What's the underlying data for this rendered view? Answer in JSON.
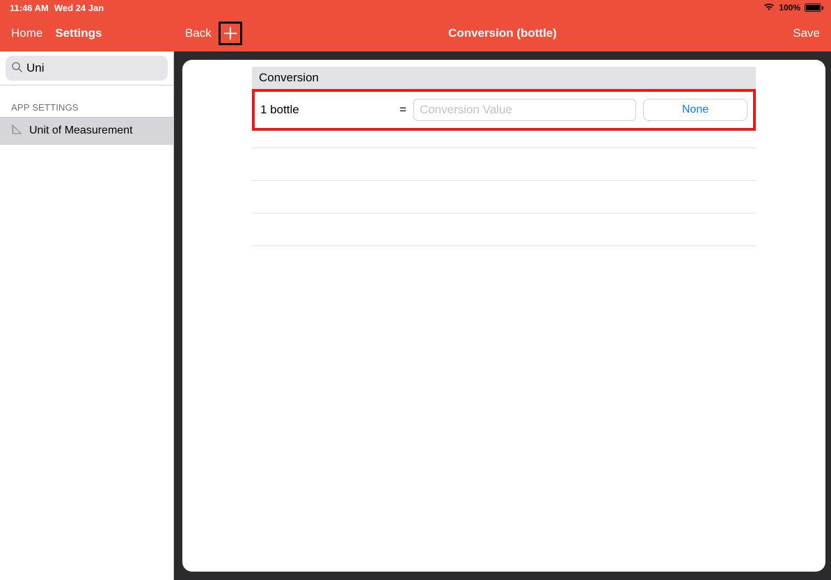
{
  "status": {
    "time": "11:46 AM",
    "date": "Wed 24 Jan",
    "battery_pct": "100%"
  },
  "sidebar_header": {
    "home_label": "Home",
    "title": "Settings"
  },
  "main_header": {
    "back_label": "Back",
    "title": "Conversion (bottle)",
    "save_label": "Save"
  },
  "search": {
    "value": "Uni"
  },
  "app_settings": {
    "header": "APP SETTINGS",
    "items": [
      {
        "label": "Unit of Measurement"
      }
    ]
  },
  "conversion": {
    "group_title": "Conversion",
    "row_label": "1 bottle",
    "equals": "=",
    "value_placeholder": "Conversion Value",
    "unit_button_label": "None"
  }
}
